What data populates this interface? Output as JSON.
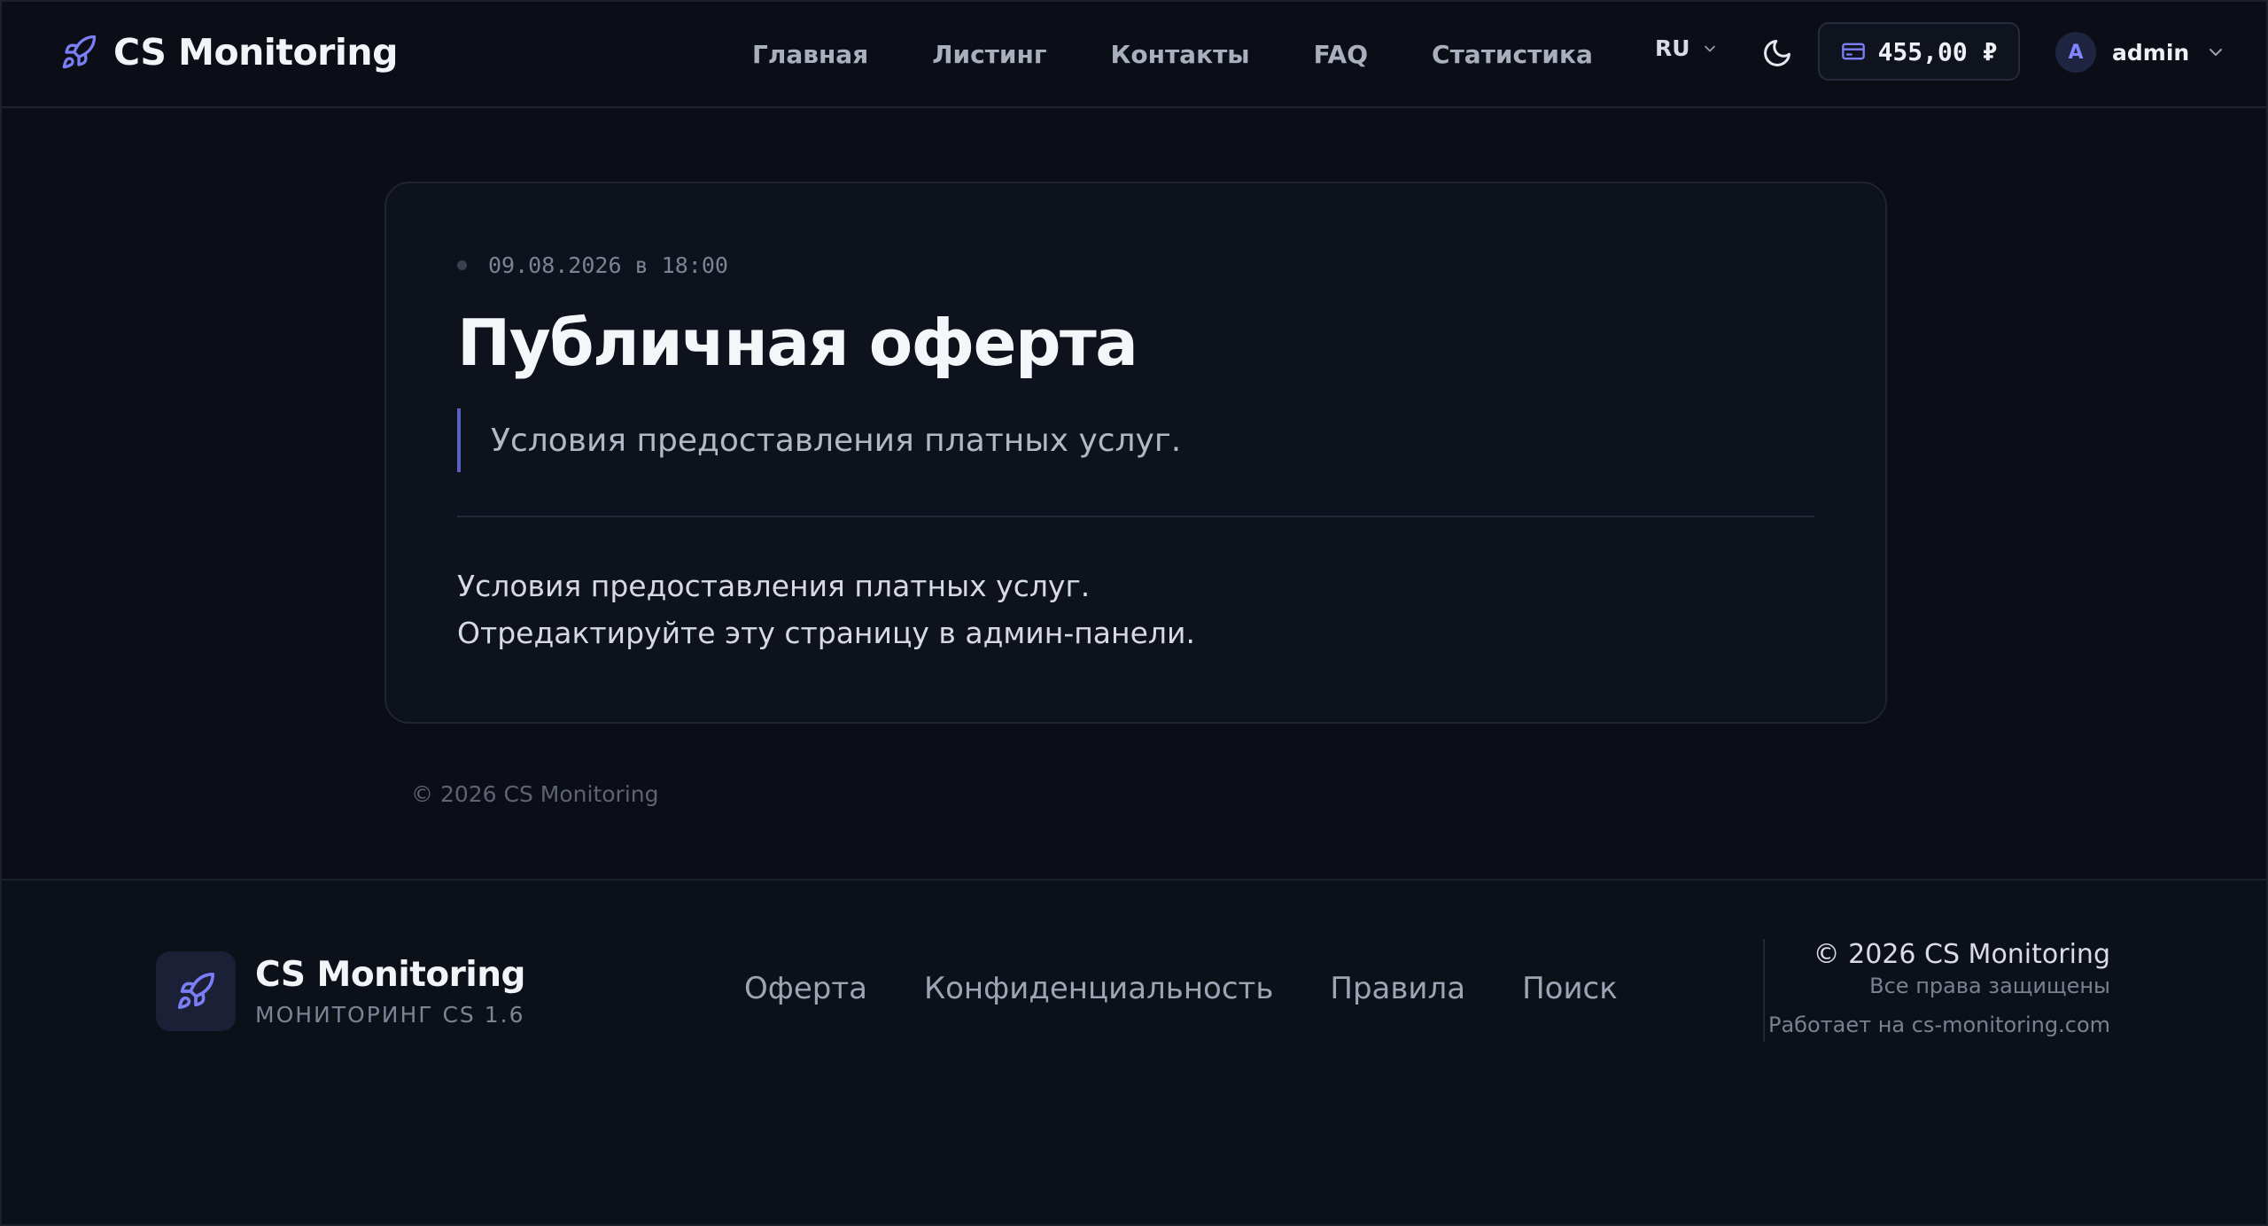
{
  "header": {
    "brand": "CS Monitoring",
    "nav": [
      "Главная",
      "Листинг",
      "Контакты",
      "FAQ",
      "Статистика"
    ],
    "language": "RU",
    "balance": "455,00 ₽",
    "user": {
      "initial": "A",
      "name": "admin"
    }
  },
  "article": {
    "date": "09.08.2026 в 18:00",
    "title": "Публичная оферта",
    "lead": "Условия предоставления платных услуг.",
    "body": [
      "Условия предоставления платных услуг.",
      "Отредактируйте эту страницу в админ-панели."
    ]
  },
  "page_copyright": "© 2026 CS Monitoring",
  "footer": {
    "brand": "CS Monitoring",
    "tagline": "МОНИТОРИНГ CS 1.6",
    "links": [
      "Оферта",
      "Конфиденциальность",
      "Правила",
      "Поиск"
    ],
    "copyright": "© 2026 CS Monitoring",
    "rights": "Все права защищены",
    "powered": "Работает на cs-monitoring.com"
  },
  "colors": {
    "background": "#0b0e17",
    "accent": "#6b6ff0",
    "card": "#0e121c"
  }
}
